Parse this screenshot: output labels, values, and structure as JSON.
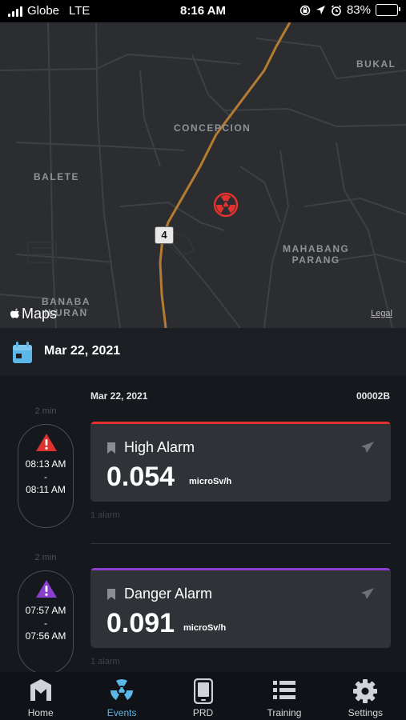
{
  "status_bar": {
    "carrier": "Globe",
    "network": "LTE",
    "time": "8:16 AM",
    "battery": "83%",
    "battery_level": 0.83
  },
  "map": {
    "places": [
      "BUKAL",
      "CONCEPCION",
      "BALETE",
      "MAHABANG",
      "PARANG",
      "BANABA",
      "ILURAN"
    ],
    "road_shield": "4",
    "brand": "Maps",
    "legal": "Legal",
    "pin_icon": "radiation-icon",
    "pin_color": "#e0322f"
  },
  "date_header": {
    "icon": "calendar-icon",
    "icon_color": "#5bb7e8",
    "date": "Mar 22, 2021"
  },
  "list_header": {
    "date": "Mar 22, 2021",
    "code": "00002B"
  },
  "events": [
    {
      "duration": "2 min",
      "time_start": "08:13 AM",
      "separator": "-",
      "time_end": "08:11 AM",
      "icon": "warning-triangle-icon",
      "accent": "#e0322f",
      "title": "High Alarm",
      "value": "0.054",
      "unit": "microSv/h",
      "count": "1 alarm"
    },
    {
      "duration": "2 min",
      "time_start": "07:57 AM",
      "separator": "-",
      "time_end": "07:56 AM",
      "icon": "warning-triangle-icon",
      "accent": "#8a3fd0",
      "title": "Danger Alarm",
      "value": "0.091",
      "unit": "microSv/h",
      "count": "1 alarm"
    }
  ],
  "tabs": [
    {
      "label": "Home",
      "icon": "home-logo-icon",
      "active": false
    },
    {
      "label": "Events",
      "icon": "radiation-icon",
      "active": true
    },
    {
      "label": "PRD",
      "icon": "device-icon",
      "active": false
    },
    {
      "label": "Training",
      "icon": "list-icon",
      "active": false
    },
    {
      "label": "Settings",
      "icon": "gear-icon",
      "active": false
    }
  ],
  "colors": {
    "accent_blue": "#5bb7e8",
    "high_alarm": "#e0322f",
    "danger_alarm": "#8a3fd0"
  }
}
